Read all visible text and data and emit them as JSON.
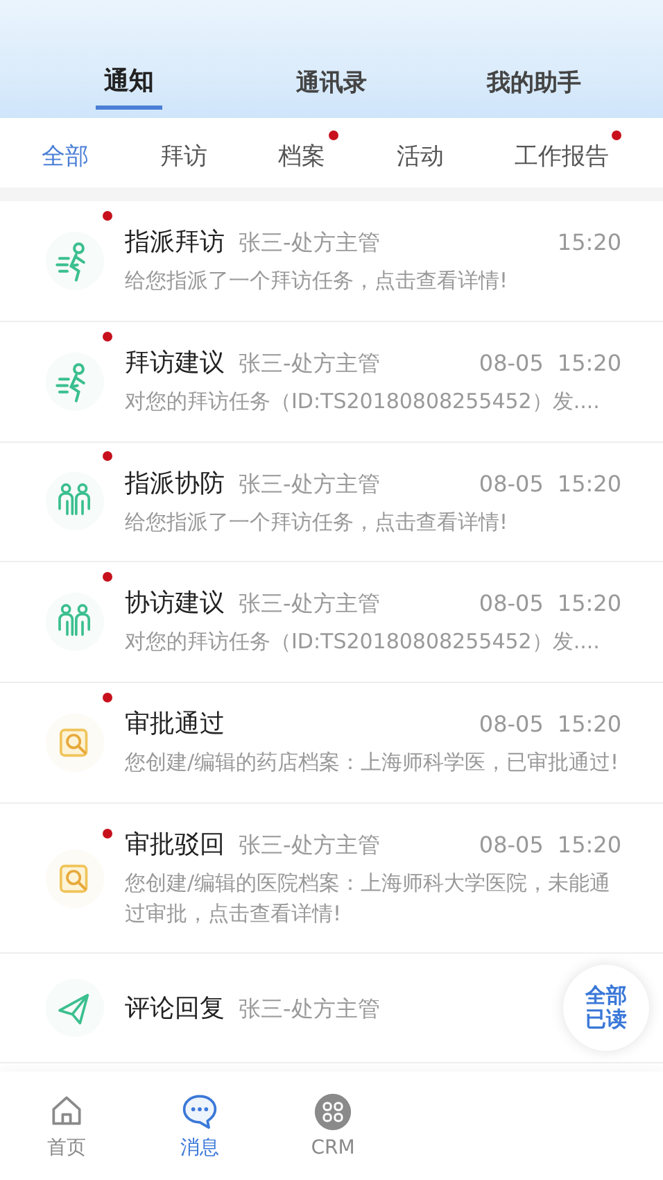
{
  "top_tabs": [
    {
      "label": "通知",
      "selected": true
    },
    {
      "label": "通讯录",
      "selected": false
    },
    {
      "label": "我的助手",
      "selected": false
    }
  ],
  "filter_tabs": [
    {
      "label": "全部",
      "selected": true,
      "dot": false
    },
    {
      "label": "拜访",
      "selected": false,
      "dot": false
    },
    {
      "label": "档案",
      "selected": false,
      "dot": true
    },
    {
      "label": "活动",
      "selected": false,
      "dot": false
    },
    {
      "label": "工作报告",
      "selected": false,
      "dot": true
    }
  ],
  "messages": [
    {
      "kind": "runner",
      "unread": true,
      "title": "指派拜访",
      "sender": "张三-处方主管",
      "time": "15:20",
      "text": "给您指派了一个拜访任务，点击查看详情!"
    },
    {
      "kind": "runner",
      "unread": true,
      "title": "拜访建议",
      "sender": "张三-处方主管",
      "date": "08-05",
      "time": "15:20",
      "text": "对您的拜访任务（ID:TS20180808255452）发...."
    },
    {
      "kind": "people",
      "unread": true,
      "title": "指派协防",
      "sender": "张三-处方主管",
      "date": "08-05",
      "time": "15:20",
      "text": "给您指派了一个拜访任务，点击查看详情!"
    },
    {
      "kind": "people",
      "unread": true,
      "title": "协访建议",
      "sender": "张三-处方主管",
      "date": "08-05",
      "time": "15:20",
      "text": "对您的拜访任务（ID:TS20180808255452）发...."
    },
    {
      "kind": "review",
      "unread": true,
      "title": "审批通过",
      "date": "08-05",
      "time": "15:20",
      "text": "您创建/编辑的药店档案：上海师科学医，已审批通过!"
    },
    {
      "kind": "review",
      "unread": true,
      "title": "审批驳回",
      "sender": "张三-处方主管",
      "date": "08-05",
      "time": "15:20",
      "text": "您创建/编辑的医院档案：上海师科大学医院，未能通过审批，点击查看详情!"
    },
    {
      "kind": "plane",
      "unread": false,
      "title": "评论回复",
      "sender": "张三-处方主管"
    }
  ],
  "mark_all_read": "全部已读",
  "bottom_nav": [
    {
      "kind": "home",
      "label": "首页",
      "selected": false
    },
    {
      "kind": "chat",
      "label": "消息",
      "selected": true
    },
    {
      "kind": "grid",
      "label": "CRM",
      "selected": false
    }
  ]
}
